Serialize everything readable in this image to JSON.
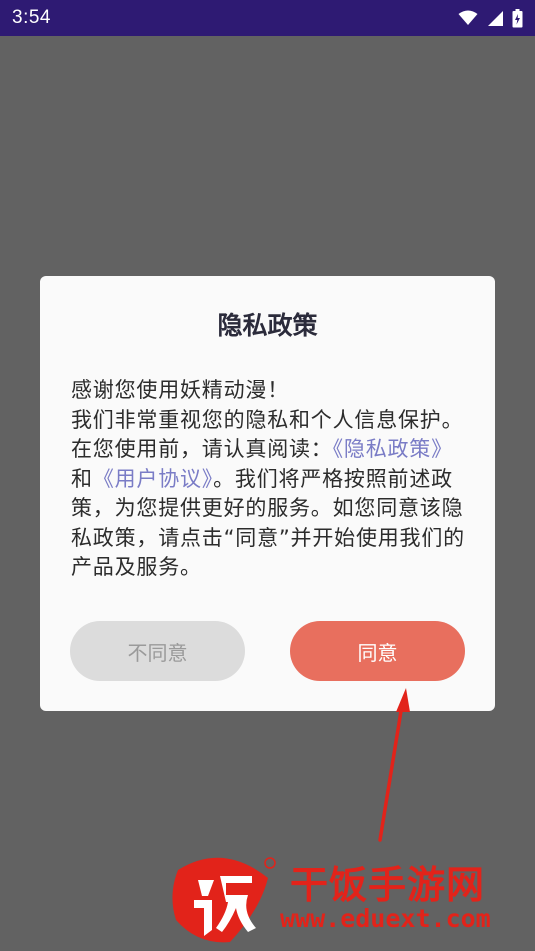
{
  "status_bar": {
    "time": "3:54",
    "icons": [
      "wifi-icon",
      "signal-icon",
      "battery-icon"
    ]
  },
  "dialog": {
    "title": "隐私政策",
    "body": {
      "line1": "感谢您使用妖精动漫！",
      "intro": "我们非常重视您的隐私和个人信息保护。在您使用前，请认真阅读：",
      "privacy_link": "《隐私政策》",
      "and": "和",
      "user_agreement_link": "《用户协议》",
      "outro": "。我们将严格按照前述政策，为您提供更好的服务。如您同意该隐私政策，请点击“同意”并开始使用我们的产品及服务。"
    },
    "disagree_label": "不同意",
    "agree_label": "同意"
  },
  "watermark": {
    "name": "干饭手游网",
    "url": "www.eduext.com"
  },
  "colors": {
    "status_bar": "#2e1a73",
    "overlay": "#626262",
    "agree_button": "#e86f5e",
    "disagree_button": "#dcdcdc",
    "link": "#7a7cc6",
    "annotation_arrow": "#e2231a"
  }
}
